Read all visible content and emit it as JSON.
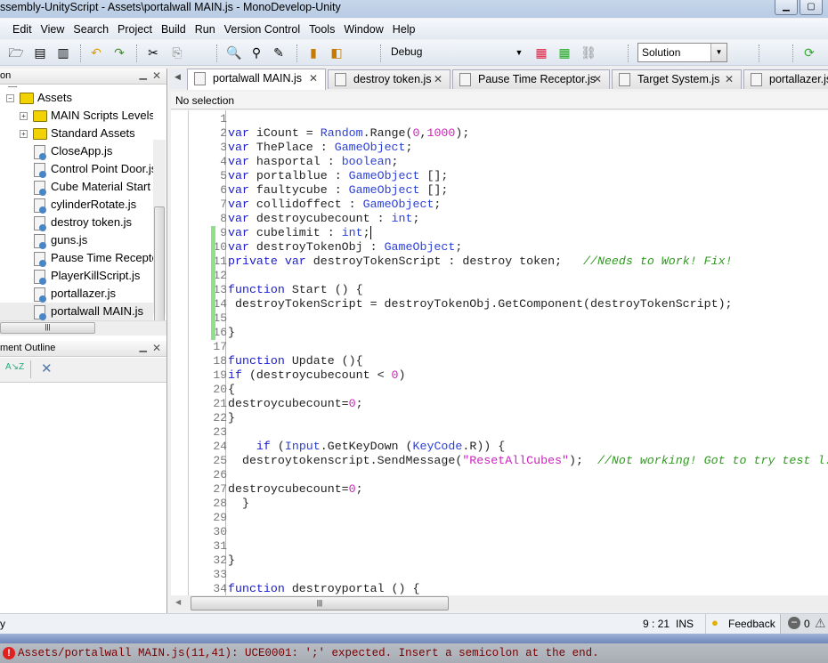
{
  "title": "ssembly-UnityScript - Assets\\portalwall MAIN.js - MonoDevelop-Unity",
  "menu": [
    "Edit",
    "View",
    "Search",
    "Project",
    "Build",
    "Run",
    "Version Control",
    "Tools",
    "Window",
    "Help"
  ],
  "toolbar": {
    "config": "Debug",
    "solution": "Solution"
  },
  "solution_panel": {
    "title": "on",
    "items": [
      {
        "label": "Assets",
        "kind": "folder",
        "expanded": true
      },
      {
        "label": "MAIN Scripts Levels",
        "kind": "folder",
        "expanded": false
      },
      {
        "label": "Standard Assets",
        "kind": "folder",
        "expanded": false
      },
      {
        "label": "CloseApp.js",
        "kind": "file"
      },
      {
        "label": "Control Point Door.js",
        "kind": "file"
      },
      {
        "label": "Cube Material Start",
        "kind": "file"
      },
      {
        "label": "cylinderRotate.js",
        "kind": "file"
      },
      {
        "label": "destroy token.js",
        "kind": "file"
      },
      {
        "label": "guns.js",
        "kind": "file"
      },
      {
        "label": "Pause Time Receptor",
        "kind": "file"
      },
      {
        "label": "PlayerKillScript.js",
        "kind": "file"
      },
      {
        "label": "portallazer.js",
        "kind": "file"
      },
      {
        "label": "portalwall MAIN.js",
        "kind": "file",
        "selected": true
      }
    ]
  },
  "outline_panel": {
    "title": "ment Outline"
  },
  "tabs": [
    {
      "label": "portalwall MAIN.js",
      "active": true
    },
    {
      "label": "destroy token.js"
    },
    {
      "label": "Pause Time Receptor.js"
    },
    {
      "label": "Target System.js"
    },
    {
      "label": "portallazer.js"
    }
  ],
  "breadcrumb": "No selection",
  "code": [
    [],
    [
      [
        "k",
        "var"
      ],
      [
        "p",
        " iCount = "
      ],
      [
        "t",
        "Random"
      ],
      [
        "p",
        ".Range("
      ],
      [
        "n",
        "0"
      ],
      [
        "p",
        ","
      ],
      [
        "n",
        "1000"
      ],
      [
        "p",
        ");"
      ]
    ],
    [
      [
        "k",
        "var"
      ],
      [
        "p",
        " ThePlace : "
      ],
      [
        "t",
        "GameObject"
      ],
      [
        "p",
        ";"
      ]
    ],
    [
      [
        "k",
        "var"
      ],
      [
        "p",
        " hasportal : "
      ],
      [
        "t",
        "boolean"
      ],
      [
        "p",
        ";"
      ]
    ],
    [
      [
        "k",
        "var"
      ],
      [
        "p",
        " portalblue : "
      ],
      [
        "t",
        "GameObject"
      ],
      [
        "p",
        " [];"
      ]
    ],
    [
      [
        "k",
        "var"
      ],
      [
        "p",
        " faultycube : "
      ],
      [
        "t",
        "GameObject"
      ],
      [
        "p",
        " [];"
      ]
    ],
    [
      [
        "k",
        "var"
      ],
      [
        "p",
        " collidoffect : "
      ],
      [
        "t",
        "GameObject"
      ],
      [
        "p",
        ";"
      ]
    ],
    [
      [
        "k",
        "var"
      ],
      [
        "p",
        " destroycubecount : "
      ],
      [
        "t",
        "int"
      ],
      [
        "p",
        ";"
      ]
    ],
    [
      [
        "k",
        "var"
      ],
      [
        "p",
        " cubelimit : "
      ],
      [
        "t",
        "int"
      ],
      [
        "p",
        ";"
      ]
    ],
    [
      [
        "k",
        "var"
      ],
      [
        "p",
        " destroyTokenObj : "
      ],
      [
        "t",
        "GameObject"
      ],
      [
        "p",
        ";"
      ]
    ],
    [
      [
        "k",
        "private"
      ],
      [
        "p",
        " "
      ],
      [
        "k",
        "var"
      ],
      [
        "p",
        " destroyTokenScript : destroy token;   "
      ],
      [
        "c",
        "//Needs to Work! Fix!"
      ]
    ],
    [],
    [
      [
        "k",
        "function"
      ],
      [
        "p",
        " Start () {"
      ]
    ],
    [
      [
        "p",
        " destroyTokenScript = destroyTokenObj.GetComponent(destroyTokenScript);"
      ]
    ],
    [],
    [
      [
        "p",
        "}"
      ]
    ],
    [],
    [
      [
        "k",
        "function"
      ],
      [
        "p",
        " Update (){"
      ]
    ],
    [
      [
        "k",
        "if"
      ],
      [
        "p",
        " (destroycubecount < "
      ],
      [
        "n",
        "0"
      ],
      [
        "p",
        ")"
      ]
    ],
    [
      [
        "p",
        "{"
      ]
    ],
    [
      [
        "p",
        "destroycubecount="
      ],
      [
        "n",
        "0"
      ],
      [
        "p",
        ";"
      ]
    ],
    [
      [
        "p",
        "}"
      ]
    ],
    [],
    [
      [
        "p",
        "    "
      ],
      [
        "k",
        "if"
      ],
      [
        "p",
        " ("
      ],
      [
        "t",
        "Input"
      ],
      [
        "p",
        ".GetKeyDown ("
      ],
      [
        "t",
        "KeyCode"
      ],
      [
        "p",
        ".R)) {"
      ]
    ],
    [
      [
        "p",
        "  destroytokenscript.SendMessage("
      ],
      [
        "s",
        "\"ResetAllCubes\""
      ],
      [
        "p",
        ");  "
      ],
      [
        "c",
        "//Not working! Got to try test l..."
      ]
    ],
    [],
    [
      [
        "p",
        "destroycubecount="
      ],
      [
        "n",
        "0"
      ],
      [
        "p",
        ";"
      ]
    ],
    [
      [
        "p",
        "  }"
      ]
    ],
    [],
    [],
    [],
    [
      [
        "p",
        "}"
      ]
    ],
    [],
    [
      [
        "k",
        "function"
      ],
      [
        "p",
        " destroyportal () {"
      ]
    ]
  ],
  "changed_lines": [
    9,
    16
  ],
  "status": {
    "left": "y",
    "position": "9 : 21",
    "mode": "INS",
    "feedback": "Feedback",
    "errors": "0"
  },
  "error_message": "Assets/portalwall MAIN.js(11,41): UCE0001: ';' expected. Insert a semicolon at the end.",
  "colors": {
    "keyword": "#1a1ad6",
    "type": "#2a3fe0",
    "number": "#d020c0",
    "comment": "#2e9a1e",
    "error": "#7a0000"
  }
}
